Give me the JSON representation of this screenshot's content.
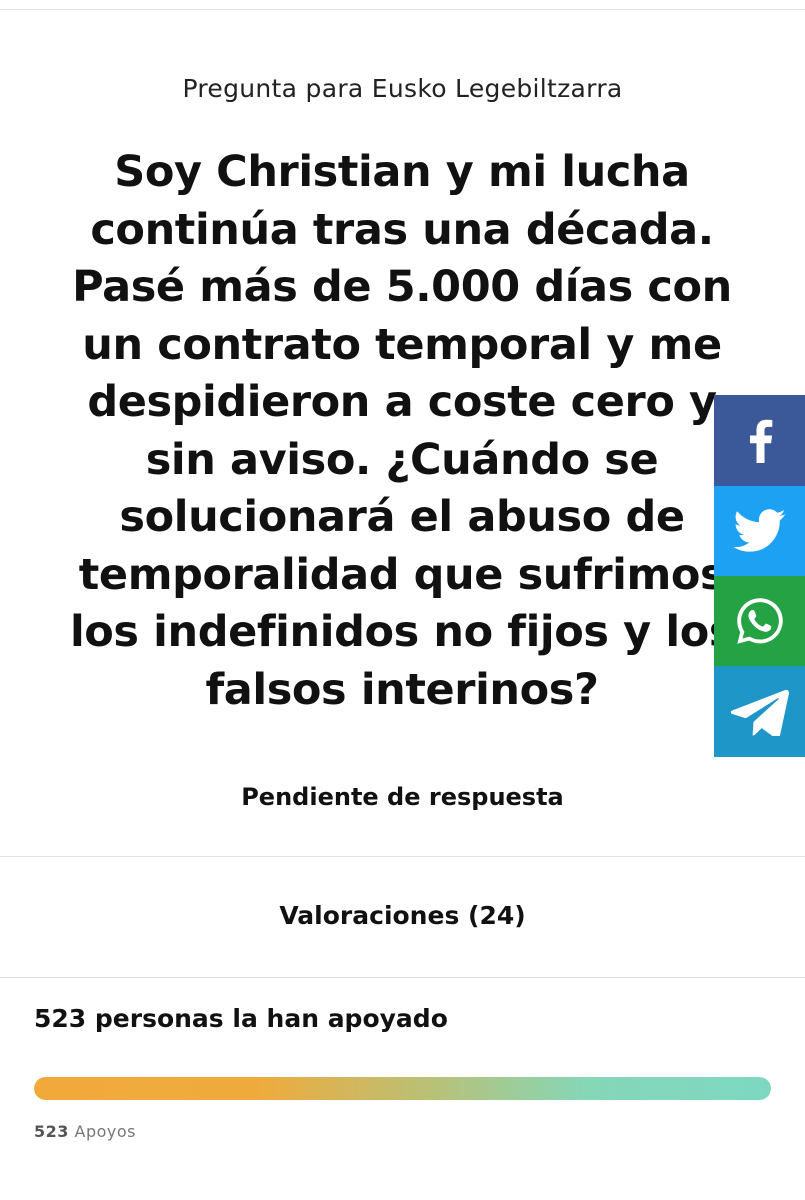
{
  "kicker": "Pregunta para Eusko Legebiltzarra",
  "question": "Soy Christian y mi lucha continúa tras una década. Pasé más de 5.000 días con un contrato temporal y me despidieron a coste cero y sin aviso. ¿Cuándo se solucionará el abuso de temporalidad que sufrimos los indefinidos no fijos y los falsos interinos?",
  "status": "Pendiente de respuesta",
  "ratings": "Valoraciones (24)",
  "support": {
    "summary": "523 personas la han apoyado",
    "count": "523",
    "unit": "Apoyos",
    "progress_percent": 100
  },
  "share": {
    "icons": [
      "facebook-icon",
      "twitter-icon",
      "whatsapp-icon",
      "telegram-icon"
    ],
    "colors": {
      "facebook": "#3b5998",
      "twitter": "#1da1f2",
      "whatsapp": "#25a244",
      "telegram": "#1e96c8"
    }
  },
  "colors": {
    "progress_start": "#f2a93b",
    "progress_end": "#7dd8c2"
  }
}
